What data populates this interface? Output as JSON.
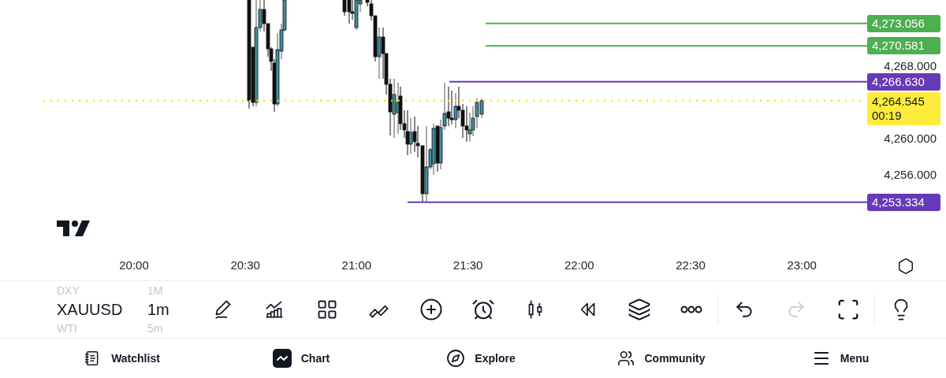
{
  "price_axis": {
    "ticks": [
      "4,268.000",
      "4,260.000",
      "4,256.000"
    ]
  },
  "price_lines": [
    {
      "kind": "solid",
      "price": "4,273.056",
      "color": "#4caf50"
    },
    {
      "kind": "solid",
      "price": "4,270.581",
      "color": "#4caf50"
    },
    {
      "kind": "solid",
      "price": "4,266.630",
      "color": "#673ab7"
    },
    {
      "kind": "solid",
      "price": "4,253.334",
      "color": "#673ab7"
    }
  ],
  "current_price": {
    "price": "4,264.545",
    "countdown": "00:19"
  },
  "time_axis": [
    "20:00",
    "20:30",
    "21:00",
    "21:30",
    "22:00",
    "22:30",
    "23:00"
  ],
  "symbol_picker": [
    {
      "symbol": "DXY",
      "interval": "1M",
      "selected": false
    },
    {
      "symbol": "XAUUSD",
      "interval": "1m",
      "selected": true
    },
    {
      "symbol": "WTI",
      "interval": "5m",
      "selected": false
    }
  ],
  "toolbar": [
    {
      "kind": "draw",
      "disabled": false
    },
    {
      "kind": "indicators",
      "disabled": false
    },
    {
      "kind": "grid",
      "disabled": false
    },
    {
      "kind": "patterns",
      "disabled": false
    },
    {
      "kind": "add",
      "disabled": false
    },
    {
      "kind": "alarm",
      "disabled": false
    },
    {
      "kind": "candles",
      "disabled": false
    },
    {
      "kind": "replay",
      "disabled": false
    },
    {
      "kind": "layers",
      "disabled": false
    },
    {
      "kind": "more",
      "disabled": false
    },
    {
      "kind": "divider"
    },
    {
      "kind": "undo",
      "disabled": false
    },
    {
      "kind": "redo",
      "disabled": true
    },
    {
      "kind": "fullscreen",
      "disabled": false
    },
    {
      "kind": "divider"
    },
    {
      "kind": "idea",
      "disabled": false
    }
  ],
  "nav": [
    {
      "kind": "watchlist",
      "label": "Watchlist",
      "selected": false
    },
    {
      "kind": "chart",
      "label": "Chart",
      "selected": true
    },
    {
      "kind": "explore",
      "label": "Explore",
      "selected": false
    },
    {
      "kind": "community",
      "label": "Community",
      "selected": false
    },
    {
      "kind": "menu",
      "label": "Menu",
      "selected": false
    }
  ]
}
